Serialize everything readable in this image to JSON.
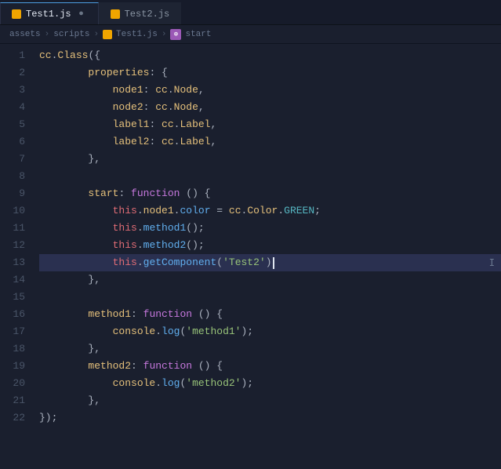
{
  "tabs": [
    {
      "id": "test1",
      "label": "Test1.js",
      "active": true,
      "modified": false
    },
    {
      "id": "test2",
      "label": "Test2.js",
      "active": false,
      "modified": false
    }
  ],
  "breadcrumb": {
    "path": [
      "assets",
      "scripts"
    ],
    "file": "Test1.js",
    "symbol": "start"
  },
  "code": {
    "lines": [
      {
        "num": 1,
        "tokens": [
          {
            "t": "cls",
            "v": "cc"
          },
          {
            "t": "punct",
            "v": "."
          },
          {
            "t": "cls",
            "v": "Class"
          },
          {
            "t": "punct",
            "v": "({"
          }
        ]
      },
      {
        "num": 2,
        "tokens": [
          {
            "t": "plain",
            "v": "        "
          },
          {
            "t": "prop",
            "v": "properties"
          },
          {
            "t": "punct",
            "v": ": {"
          }
        ]
      },
      {
        "num": 3,
        "tokens": [
          {
            "t": "plain",
            "v": "            "
          },
          {
            "t": "prop",
            "v": "node1"
          },
          {
            "t": "punct",
            "v": ": "
          },
          {
            "t": "cc",
            "v": "cc"
          },
          {
            "t": "punct",
            "v": "."
          },
          {
            "t": "cc",
            "v": "Node"
          },
          {
            "t": "punct",
            "v": ","
          }
        ]
      },
      {
        "num": 4,
        "tokens": [
          {
            "t": "plain",
            "v": "            "
          },
          {
            "t": "prop",
            "v": "node2"
          },
          {
            "t": "punct",
            "v": ": "
          },
          {
            "t": "cc",
            "v": "cc"
          },
          {
            "t": "punct",
            "v": "."
          },
          {
            "t": "cc",
            "v": "Node"
          },
          {
            "t": "punct",
            "v": ","
          }
        ]
      },
      {
        "num": 5,
        "tokens": [
          {
            "t": "plain",
            "v": "            "
          },
          {
            "t": "prop",
            "v": "label1"
          },
          {
            "t": "punct",
            "v": ": "
          },
          {
            "t": "cc",
            "v": "cc"
          },
          {
            "t": "punct",
            "v": "."
          },
          {
            "t": "cc",
            "v": "Label"
          },
          {
            "t": "punct",
            "v": ","
          }
        ]
      },
      {
        "num": 6,
        "tokens": [
          {
            "t": "plain",
            "v": "            "
          },
          {
            "t": "prop",
            "v": "label2"
          },
          {
            "t": "punct",
            "v": ": "
          },
          {
            "t": "cc",
            "v": "cc"
          },
          {
            "t": "punct",
            "v": "."
          },
          {
            "t": "cc",
            "v": "Label"
          },
          {
            "t": "punct",
            "v": ","
          }
        ]
      },
      {
        "num": 7,
        "tokens": [
          {
            "t": "plain",
            "v": "        "
          },
          {
            "t": "punct",
            "v": "},"
          }
        ]
      },
      {
        "num": 8,
        "tokens": []
      },
      {
        "num": 9,
        "tokens": [
          {
            "t": "plain",
            "v": "        "
          },
          {
            "t": "prop",
            "v": "start"
          },
          {
            "t": "punct",
            "v": ": "
          },
          {
            "t": "kw",
            "v": "function"
          },
          {
            "t": "plain",
            "v": " "
          },
          {
            "t": "punct",
            "v": "() {"
          }
        ]
      },
      {
        "num": 10,
        "tokens": [
          {
            "t": "plain",
            "v": "            "
          },
          {
            "t": "this-kw",
            "v": "this"
          },
          {
            "t": "punct",
            "v": "."
          },
          {
            "t": "prop",
            "v": "node1"
          },
          {
            "t": "punct",
            "v": "."
          },
          {
            "t": "fn-name",
            "v": "color"
          },
          {
            "t": "punct",
            "v": " = "
          },
          {
            "t": "cc",
            "v": "cc"
          },
          {
            "t": "punct",
            "v": "."
          },
          {
            "t": "cc",
            "v": "Color"
          },
          {
            "t": "punct",
            "v": "."
          },
          {
            "t": "green",
            "v": "GREEN"
          },
          {
            "t": "punct",
            "v": ";"
          }
        ]
      },
      {
        "num": 11,
        "tokens": [
          {
            "t": "plain",
            "v": "            "
          },
          {
            "t": "this-kw",
            "v": "this"
          },
          {
            "t": "punct",
            "v": "."
          },
          {
            "t": "fn-name",
            "v": "method1"
          },
          {
            "t": "punct",
            "v": "();"
          }
        ]
      },
      {
        "num": 12,
        "tokens": [
          {
            "t": "plain",
            "v": "            "
          },
          {
            "t": "this-kw",
            "v": "this"
          },
          {
            "t": "punct",
            "v": "."
          },
          {
            "t": "fn-name",
            "v": "method2"
          },
          {
            "t": "punct",
            "v": "();"
          }
        ]
      },
      {
        "num": 13,
        "tokens": [
          {
            "t": "plain",
            "v": "            "
          },
          {
            "t": "this-kw",
            "v": "this"
          },
          {
            "t": "punct",
            "v": "."
          },
          {
            "t": "fn-name",
            "v": "getComponent"
          },
          {
            "t": "punct",
            "v": "("
          },
          {
            "t": "string",
            "v": "'Test2'"
          },
          {
            "t": "punct",
            "v": ")"
          }
        ],
        "cursor": true
      },
      {
        "num": 14,
        "tokens": [
          {
            "t": "plain",
            "v": "        "
          },
          {
            "t": "punct",
            "v": "},"
          }
        ]
      },
      {
        "num": 15,
        "tokens": []
      },
      {
        "num": 16,
        "tokens": [
          {
            "t": "plain",
            "v": "        "
          },
          {
            "t": "prop",
            "v": "method1"
          },
          {
            "t": "punct",
            "v": ": "
          },
          {
            "t": "kw",
            "v": "function"
          },
          {
            "t": "plain",
            "v": " "
          },
          {
            "t": "punct",
            "v": "() {"
          }
        ]
      },
      {
        "num": 17,
        "tokens": [
          {
            "t": "plain",
            "v": "            "
          },
          {
            "t": "cc",
            "v": "console"
          },
          {
            "t": "punct",
            "v": "."
          },
          {
            "t": "fn-name",
            "v": "log"
          },
          {
            "t": "punct",
            "v": "("
          },
          {
            "t": "string",
            "v": "'method1'"
          },
          {
            "t": "punct",
            "v": "();"
          }
        ]
      },
      {
        "num": 18,
        "tokens": [
          {
            "t": "plain",
            "v": "        "
          },
          {
            "t": "punct",
            "v": "},"
          }
        ]
      },
      {
        "num": 19,
        "tokens": [
          {
            "t": "plain",
            "v": "        "
          },
          {
            "t": "prop",
            "v": "method2"
          },
          {
            "t": "punct",
            "v": ": "
          },
          {
            "t": "kw",
            "v": "function"
          },
          {
            "t": "plain",
            "v": " "
          },
          {
            "t": "punct",
            "v": "() {"
          }
        ]
      },
      {
        "num": 20,
        "tokens": [
          {
            "t": "plain",
            "v": "            "
          },
          {
            "t": "cc",
            "v": "console"
          },
          {
            "t": "punct",
            "v": "."
          },
          {
            "t": "fn-name",
            "v": "log"
          },
          {
            "t": "punct",
            "v": "("
          },
          {
            "t": "string",
            "v": "'method2'"
          },
          {
            "t": "punct",
            "v": "();"
          }
        ]
      },
      {
        "num": 21,
        "tokens": [
          {
            "t": "plain",
            "v": "        "
          },
          {
            "t": "punct",
            "v": "},"
          }
        ]
      },
      {
        "num": 22,
        "tokens": [
          {
            "t": "punct",
            "v": "});"
          }
        ]
      }
    ]
  },
  "colors": {
    "bg": "#1a1f2e",
    "tab_active_bg": "#1a1f2e",
    "tab_inactive_bg": "#1e2433",
    "highlight_line": "#2a3050",
    "cursor_line": "#232840",
    "line_num": "#4a5568",
    "accent": "#4d9de0"
  }
}
